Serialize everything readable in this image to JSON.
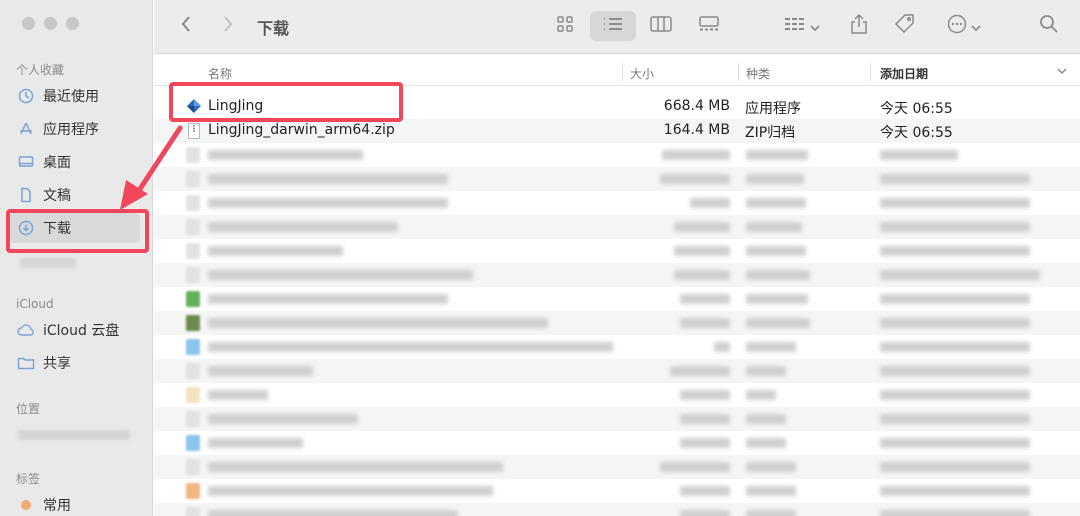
{
  "window": {
    "title": "下载"
  },
  "sidebar": {
    "sections": [
      {
        "title": "个人收藏",
        "items": [
          {
            "label": "最近使用",
            "icon": "clock-icon"
          },
          {
            "label": "应用程序",
            "icon": "apps-icon"
          },
          {
            "label": "桌面",
            "icon": "desktop-icon"
          },
          {
            "label": "文稿",
            "icon": "document-icon"
          },
          {
            "label": "下载",
            "icon": "download-icon",
            "selected": true
          }
        ]
      },
      {
        "title": "iCloud",
        "items": [
          {
            "label": "iCloud 云盘",
            "icon": "cloud-icon"
          },
          {
            "label": "共享",
            "icon": "shared-folder-icon"
          }
        ]
      },
      {
        "title": "位置",
        "items": []
      },
      {
        "title": "标签",
        "items": [
          {
            "label": "常用",
            "icon": "tag-dot-icon"
          }
        ]
      }
    ]
  },
  "toolbar": {
    "view_modes": [
      "icon-view",
      "list-view",
      "column-view",
      "gallery-view"
    ],
    "active_view": "list-view"
  },
  "columns": {
    "name": "名称",
    "size": "大小",
    "kind": "种类",
    "date": "添加日期"
  },
  "files": [
    {
      "name": "LingJing",
      "size": "668.4 MB",
      "kind": "应用程序",
      "date": "今天 06:55",
      "highlighted": true
    },
    {
      "name": "LingJing_darwin_arm64.zip",
      "size": "164.4 MB",
      "kind": "ZIP归档",
      "date": "今天 06:55"
    }
  ],
  "colors": {
    "annotation": "#f1475d",
    "sidebar_bg": "#e9e9e9",
    "row_alt": "#f4f5f5"
  }
}
